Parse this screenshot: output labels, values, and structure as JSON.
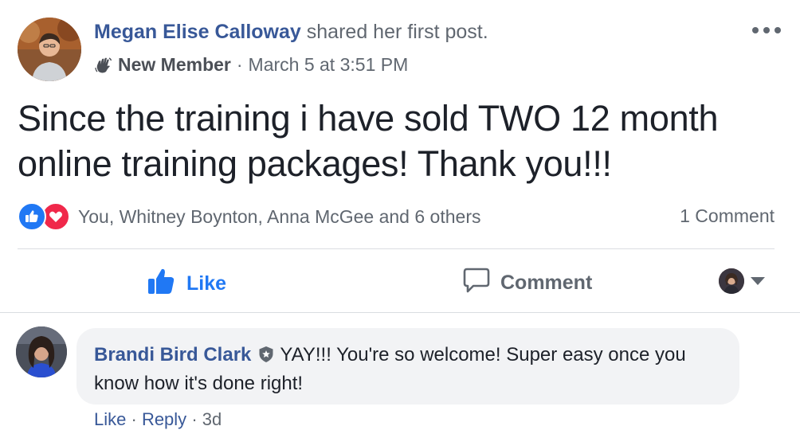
{
  "post": {
    "author_name": "Megan Elise Calloway",
    "author_action": "shared her first post.",
    "badge_label": "New Member",
    "separator": "·",
    "timestamp": "March 5 at 3:51 PM",
    "text": "Since the training i have sold TWO 12 month online training packages! Thank you!!!",
    "more_options_icon": "ellipsis-icon"
  },
  "reactions": {
    "types": [
      "like-icon",
      "love-icon"
    ],
    "summary": "You, Whitney Boynton, Anna McGee and 6 others",
    "comment_count": "1 Comment"
  },
  "actions": {
    "like_label": "Like",
    "comment_label": "Comment"
  },
  "comment": {
    "author_name": "Brandi Bird Clark",
    "text": "YAY!!! You're so welcome! Super easy once you know how it's done right!",
    "like_link": "Like",
    "reply_link": "Reply",
    "time": "3d",
    "dot": "·"
  },
  "colors": {
    "link_blue": "#385898",
    "like_blue": "#2078f4",
    "love_red": "#f0284a",
    "meta_gray": "#606770",
    "bubble_gray": "#f2f3f5"
  }
}
